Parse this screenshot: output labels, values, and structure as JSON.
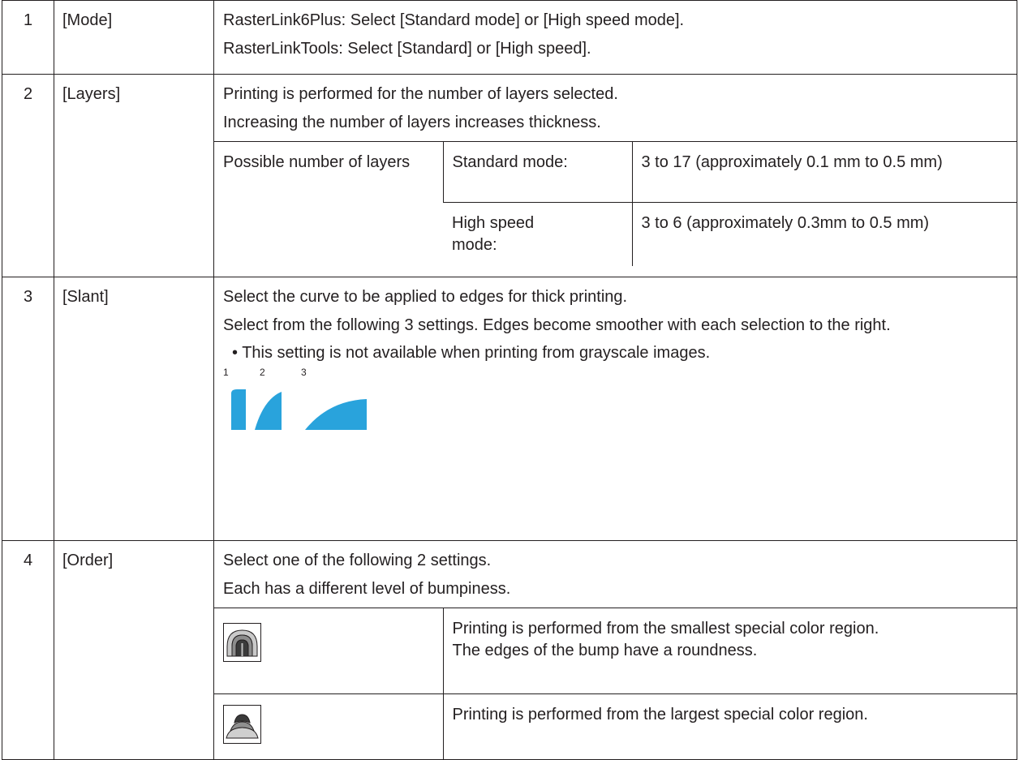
{
  "rows": [
    {
      "num": "1",
      "name": "[Mode]",
      "lines": [
        "RasterLink6Plus: Select [Standard mode] or [High speed mode].",
        "RasterLinkTools: Select [Standard] or [High speed]."
      ]
    },
    {
      "num": "2",
      "name": "[Layers]",
      "lines": [
        "Printing is performed for the number of layers selected.",
        "Increasing the number of layers increases thickness."
      ],
      "sub": {
        "label": "Possible number of layers",
        "modes": [
          {
            "mode": "Standard mode:",
            "range": "3 to 17 (approximately 0.1 mm to 0.5 mm)"
          },
          {
            "mode": "High speed mode:",
            "range": "3 to 6 (approximately 0.3mm to 0.5 mm)"
          }
        ]
      }
    },
    {
      "num": "3",
      "name": "[Slant]",
      "lines": [
        "Select the curve to be applied to edges for thick printing.",
        "Select from the following 3 settings. Edges become smoother with each selection to the right."
      ],
      "bullet": "• This setting is not available when printing from grayscale images.",
      "slant_labels": [
        "1",
        "2",
        "3"
      ],
      "slant_color": "#29a3dc"
    },
    {
      "num": "4",
      "name": "[Order]",
      "lines": [
        "Select one of the following 2 settings.",
        "Each has a different level of bumpiness."
      ],
      "options": [
        {
          "icon": "small-region-first-icon",
          "text": "Printing is performed from the smallest special color region.\nThe edges of the bump have a roundness."
        },
        {
          "icon": "large-region-first-icon",
          "text": "Printing is performed from the largest special color region."
        }
      ]
    }
  ]
}
